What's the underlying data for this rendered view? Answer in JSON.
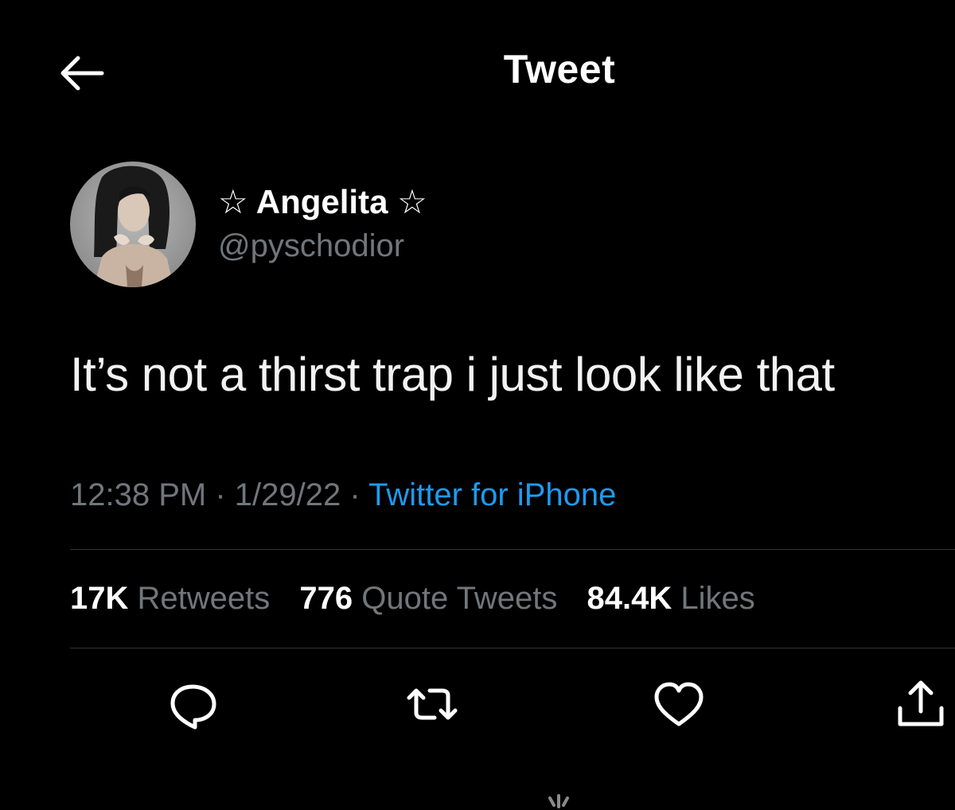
{
  "header": {
    "back_icon": "arrow-left-icon",
    "title": "Tweet"
  },
  "author": {
    "display_name": "☆ Angelita ☆",
    "handle": "@pyschodior",
    "avatar": "profile-photo"
  },
  "tweet": {
    "text": "It’s not a thirst trap i just look like that",
    "time": "12:38 PM",
    "date": "1/29/22",
    "separator": "·",
    "source": "Twitter for iPhone"
  },
  "stats": {
    "retweets_count": "17K",
    "retweets_label": "Retweets",
    "quotes_count": "776",
    "quotes_label": "Quote Tweets",
    "likes_count": "84.4K",
    "likes_label": "Likes"
  },
  "actions": {
    "reply_icon": "reply-icon",
    "retweet_icon": "retweet-icon",
    "like_icon": "heart-icon",
    "share_icon": "share-icon"
  },
  "colors": {
    "background": "#000000",
    "primary_text": "#ffffff",
    "secondary_text": "#71767b",
    "link": "#1d9bf0",
    "divider": "#2f3336"
  }
}
